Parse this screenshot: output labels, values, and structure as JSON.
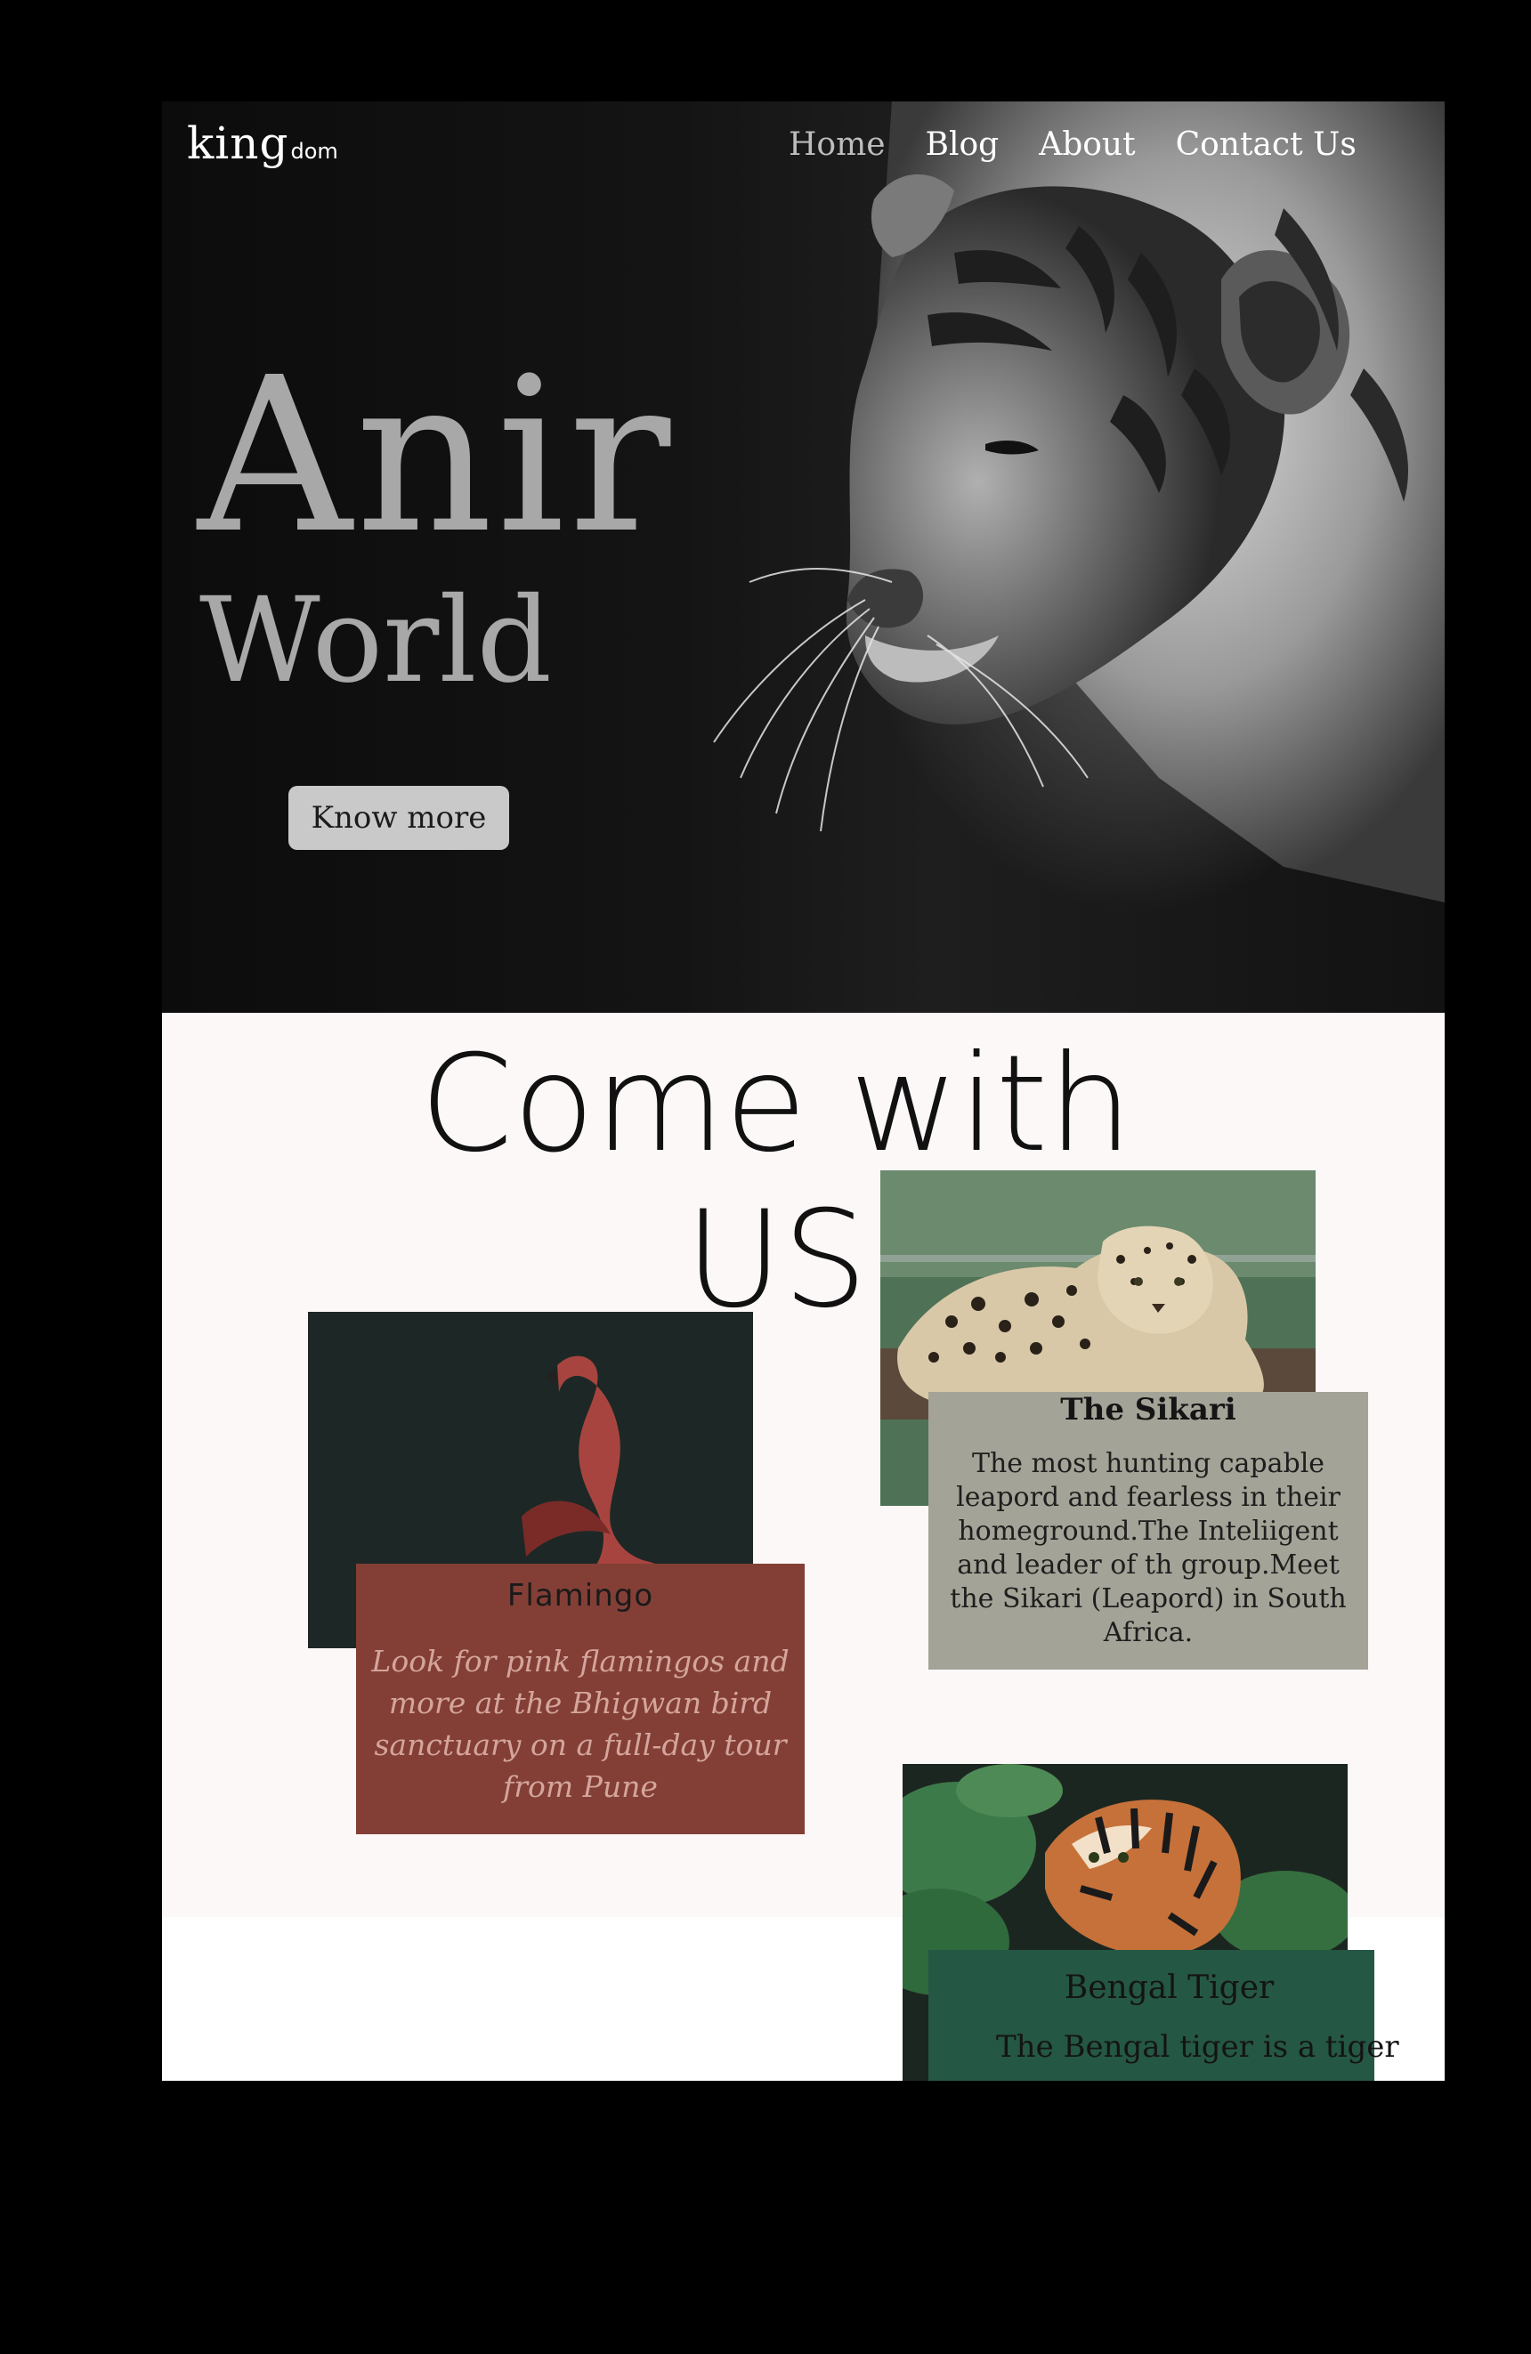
{
  "header": {
    "logo_main": "king",
    "logo_sub": "dom",
    "nav": [
      "Home",
      "Blog",
      "About",
      "Contact Us"
    ],
    "active_nav": "Home"
  },
  "hero": {
    "title_line1": "Anir",
    "title_line2": "World",
    "cta_label": "Know more"
  },
  "section": {
    "title": "Come with US",
    "cards": [
      {
        "title": "Flamingo",
        "description": "Look for pink flamingos and more at the Bhigwan bird sanctuary on a full-day tour from Pune",
        "color": "#833f36"
      },
      {
        "title": "The Sikari",
        "description": "The most hunting capable leapord and fearless in their homeground.The Inteliigent and leader of th group.Meet the Sikari (Leapord) in South Africa.",
        "color": "#a4a397"
      },
      {
        "title": "Bengal Tiger",
        "description": "The Bengal tiger is a tiger",
        "color": "#245744"
      }
    ]
  },
  "colors": {
    "page_bg": "#000000",
    "section_bg": "#fcf8f7",
    "hero_text": "#a8a8a8",
    "button_bg": "#c9c9c9"
  }
}
